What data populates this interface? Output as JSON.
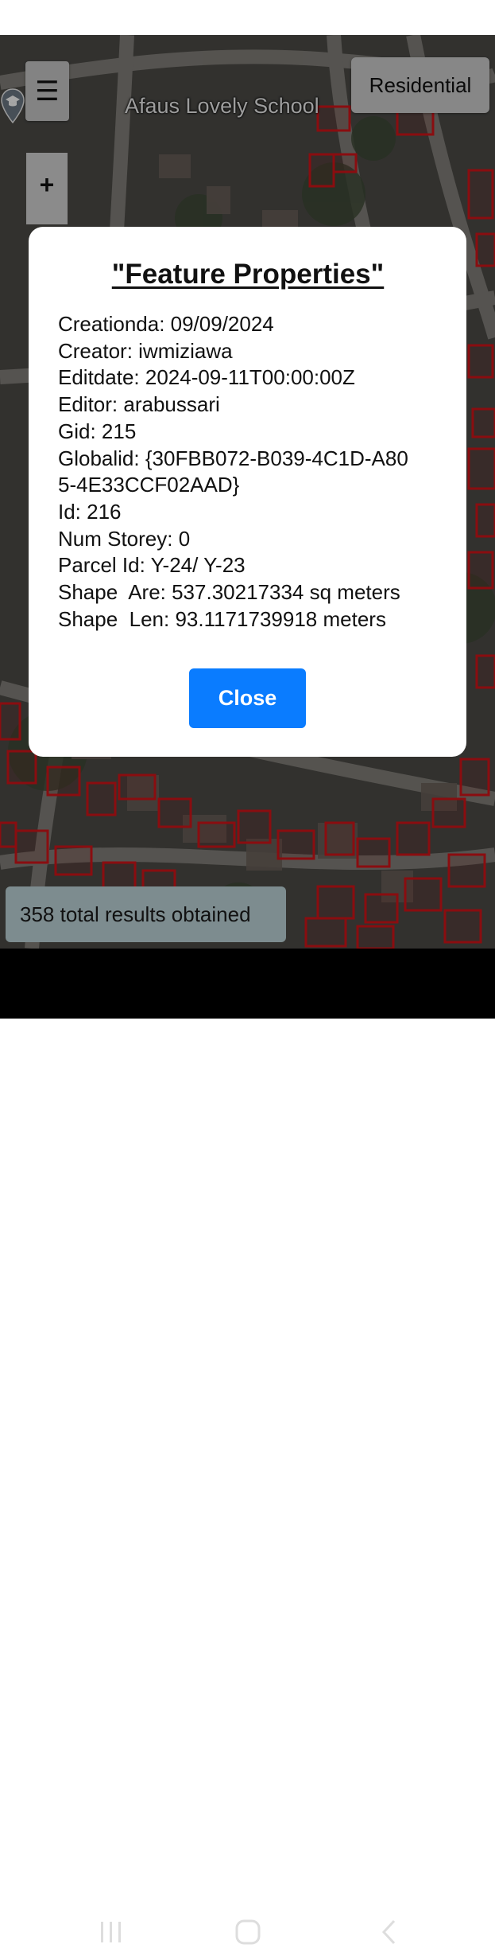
{
  "map": {
    "place_label": "Afaus Lovely School",
    "menu_icon": "☰",
    "zoom_in_label": "+",
    "landuse_button_label": "Residential",
    "parcel_outline_color": "#d4141a"
  },
  "modal": {
    "title": "\"Feature Properties\"",
    "properties": [
      "Creationda: 09/09/2024",
      "Creator: iwmiziawa",
      "Editdate: 2024-09-11T00:00:00Z",
      "Editor: arabussari",
      "Gid: 215",
      "Globalid: {30FBB072-B039-4C1D-A80",
      "5-4E33CCF02AAD}",
      "Id: 216",
      "Num Storey: 0",
      "Parcel Id: Y-24/ Y-23",
      "Shape  Are: 537.30217334 sq meters",
      "Shape  Len: 93.1171739918 meters"
    ],
    "close_label": "Close",
    "close_color": "#0a7cff"
  },
  "results": {
    "text": "358 total results obtained"
  },
  "nav": {
    "icons": [
      "recent-apps-icon",
      "home-icon",
      "back-icon"
    ]
  }
}
